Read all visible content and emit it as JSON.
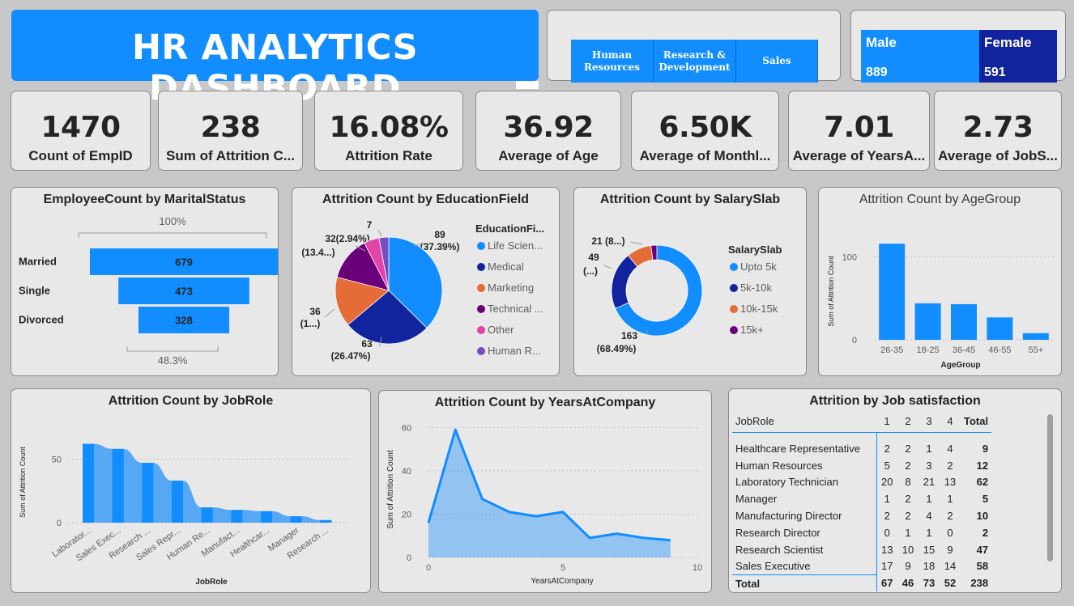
{
  "header": {
    "title": "HR ANALYTICS DASHBOARD"
  },
  "department_slicer": [
    "Human Resources",
    "Research & Development",
    "Sales"
  ],
  "department_slicer_lines": [
    [
      "Human",
      "Resources"
    ],
    [
      "Research &",
      "Development"
    ],
    [
      "Sales"
    ]
  ],
  "gender": [
    {
      "label": "Male",
      "value": "889",
      "color": "#118dff"
    },
    {
      "label": "Female",
      "value": "591",
      "color": "#12239e"
    }
  ],
  "kpis": [
    {
      "value": "1470",
      "label": "Count of EmpID"
    },
    {
      "value": "238",
      "label": "Sum of Attrition C..."
    },
    {
      "value": "16.08%",
      "label": "Attrition Rate"
    },
    {
      "value": "36.92",
      "label": "Average of Age"
    },
    {
      "value": "6.50K",
      "label": "Average of Monthl..."
    },
    {
      "value": "7.01",
      "label": "Average of YearsA..."
    },
    {
      "value": "2.73",
      "label": "Average of JobS..."
    }
  ],
  "colors": {
    "accent": "#118dff",
    "dark_blue": "#12239e",
    "orange": "#e66c37",
    "purple": "#6b007b",
    "pink": "#e044a7",
    "violet": "#744ec2"
  },
  "chart_data": [
    {
      "type": "funnel",
      "title": "EmployeeCount by MaritalStatus",
      "categories": [
        "Married",
        "Single",
        "Divorced"
      ],
      "values": [
        679,
        473,
        328
      ],
      "value_labels": [
        "679",
        "473",
        "328"
      ],
      "top_percent": "100%",
      "bottom_percent": "48.3%"
    },
    {
      "type": "pie",
      "title": "Attrition Count by EducationField",
      "legend_title": "EducationFi...",
      "legend": [
        "Life Scien...",
        "Medical",
        "Marketing",
        "Technical ...",
        "Other",
        "Human R..."
      ],
      "categories": [
        "Life Sciences",
        "Medical",
        "Marketing",
        "Technical Degree",
        "Other",
        "Human Resources"
      ],
      "values": [
        89,
        63,
        36,
        32,
        11,
        7
      ],
      "colors": [
        "#118dff",
        "#12239e",
        "#e66c37",
        "#6b007b",
        "#e044a7",
        "#744ec2"
      ],
      "data_labels": [
        "89",
        "(37.39%)",
        "63",
        "(26.47%)",
        "36",
        "(1...)",
        "32(2.94%)",
        "(13.4...)",
        "7"
      ]
    },
    {
      "type": "donut",
      "title": "Attrition Count by SalarySlab",
      "legend_title": "SalarySlab",
      "legend": [
        "Upto 5k",
        "5k-10k",
        "10k-15k",
        "15k+"
      ],
      "values": [
        163,
        49,
        21,
        5
      ],
      "colors": [
        "#118dff",
        "#12239e",
        "#e66c37",
        "#6b007b"
      ],
      "data_labels": [
        "163",
        "(68.49%)",
        "49",
        "(...)",
        "21 (8...)"
      ]
    },
    {
      "type": "bar",
      "title": "Attrition Count by AgeGroup",
      "categories": [
        "26-35",
        "18-25",
        "36-45",
        "46-55",
        "55+"
      ],
      "values": [
        116,
        44,
        43,
        27,
        8
      ],
      "xlabel": "AgeGroup",
      "ylabel": "Sum of Attrition Count",
      "yticks": [
        "0",
        "100"
      ],
      "ylim": [
        0,
        125
      ]
    },
    {
      "type": "area",
      "title": "Attrition Count by JobRole",
      "categories": [
        "Laborator...",
        "Sales Exec...",
        "Research ...",
        "Sales Repr...",
        "Human Re...",
        "Manufact...",
        "Healthcar...",
        "Manager",
        "Research ..."
      ],
      "values": [
        62,
        58,
        47,
        33,
        12,
        10,
        9,
        5,
        2
      ],
      "xlabel": "JobRole",
      "ylabel": "Sum of Attrition Count",
      "yticks": [
        "0",
        "50"
      ],
      "ylim": [
        0,
        70
      ]
    },
    {
      "type": "area",
      "title": "Attrition Count by YearsAtCompany",
      "x": [
        0,
        1,
        2,
        3,
        4,
        5,
        6,
        7,
        8,
        9
      ],
      "values": [
        16,
        59,
        27,
        21,
        19,
        21,
        9,
        11,
        9,
        8
      ],
      "xlabel": "YearsAtCompany",
      "ylabel": "Sum of Attrition Count",
      "xticks": [
        "0",
        "5",
        "10"
      ],
      "yticks": [
        "0",
        "20",
        "40",
        "60"
      ],
      "xlim": [
        0,
        10
      ],
      "ylim": [
        0,
        62
      ]
    },
    {
      "type": "table",
      "title": "Attrition by Job satisfaction",
      "columns": [
        "JobRole",
        "1",
        "2",
        "3",
        "4",
        "Total"
      ],
      "rows": [
        [
          "Healthcare Representative",
          "2",
          "2",
          "1",
          "4",
          "9"
        ],
        [
          "Human Resources",
          "5",
          "2",
          "3",
          "2",
          "12"
        ],
        [
          "Laboratory Technician",
          "20",
          "8",
          "21",
          "13",
          "62"
        ],
        [
          "Manager",
          "1",
          "2",
          "1",
          "1",
          "5"
        ],
        [
          "Manufacturing Director",
          "2",
          "2",
          "4",
          "2",
          "10"
        ],
        [
          "Research Director",
          "0",
          "1",
          "1",
          "0",
          "2"
        ],
        [
          "Research Scientist",
          "13",
          "10",
          "15",
          "9",
          "47"
        ],
        [
          "Sales Executive",
          "17",
          "9",
          "18",
          "14",
          "58"
        ]
      ],
      "total": [
        "Total",
        "67",
        "46",
        "73",
        "52",
        "238"
      ]
    }
  ]
}
